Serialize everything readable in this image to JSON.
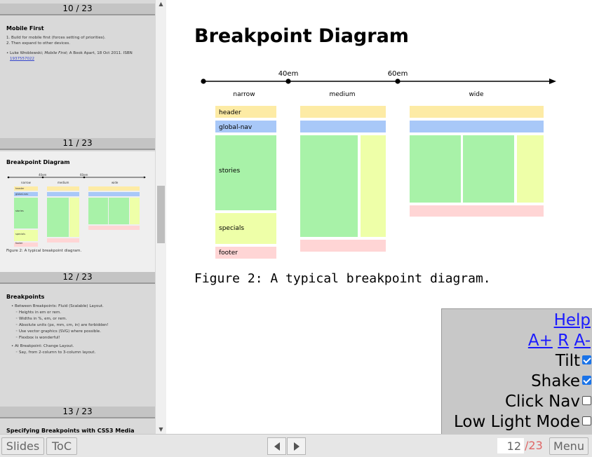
{
  "sidebar": {
    "thumbs": [
      {
        "counter": "10 / 23",
        "title": "Mobile First",
        "lines": [
          "1. Build for mobile first (forces setting of priorities).",
          "2. Then expand to other devices."
        ],
        "ref_prefix": "• Luke Wroblewski; ",
        "ref_book": "Mobile First",
        "ref_suffix": "; A Book Apart, 18 Oct 2011. ISBN",
        "ref_link": "1937557022"
      },
      {
        "counter": "11 / 23",
        "title": "Breakpoint Diagram",
        "caption": "Figure 2: A typical breakpoint diagram."
      },
      {
        "counter": "12 / 23",
        "title": "Breakpoints",
        "lines": [
          "• Between Breakpoints: Fluid (Scalable) Layout.",
          "◦ Heights in em or rem.",
          "◦ Widths in %, em, or rem.",
          "◦ Absolute units (px, mm, cm, in) are forbidden!",
          "◦ Use vector graphics (SVG) where possible.",
          "◦ Flexbox is wonderful!",
          "• At Breakpoint: Change Layout.",
          "◦ Say, from 2-column to 3-column layout."
        ]
      },
      {
        "counter": "13 / 23",
        "title": "Specifying Breakpoints with CSS3 Media"
      }
    ]
  },
  "slide": {
    "title": "Breakpoint Diagram",
    "caption": "Figure 2: A typical breakpoint diagram.",
    "diagram": {
      "breakpoints": [
        "40em",
        "60em"
      ],
      "ranges": [
        "narrow",
        "medium",
        "wide"
      ],
      "boxes": [
        "header",
        "global-nav",
        "stories",
        "specials",
        "footer"
      ],
      "colors": {
        "header": "#fdeba5",
        "global-nav": "#a8c8f8",
        "stories": "#a8f2a8",
        "specials": "#eeffa8",
        "footer": "#ffd5d5"
      }
    }
  },
  "settings": {
    "help": "Help",
    "font_plus": "A+",
    "font_reset": "R",
    "font_minus": "A-",
    "tilt": {
      "label": "Tilt",
      "checked": true
    },
    "shake": {
      "label": "Shake",
      "checked": true
    },
    "click_nav": {
      "label": "Click Nav",
      "checked": false
    },
    "low_light": {
      "label": "Low Light Mode",
      "checked": false
    }
  },
  "toolbar": {
    "slides_label": "Slides",
    "toc_label": "ToC",
    "page_value": "12",
    "page_total": "/23",
    "menu_label": "Menu"
  }
}
